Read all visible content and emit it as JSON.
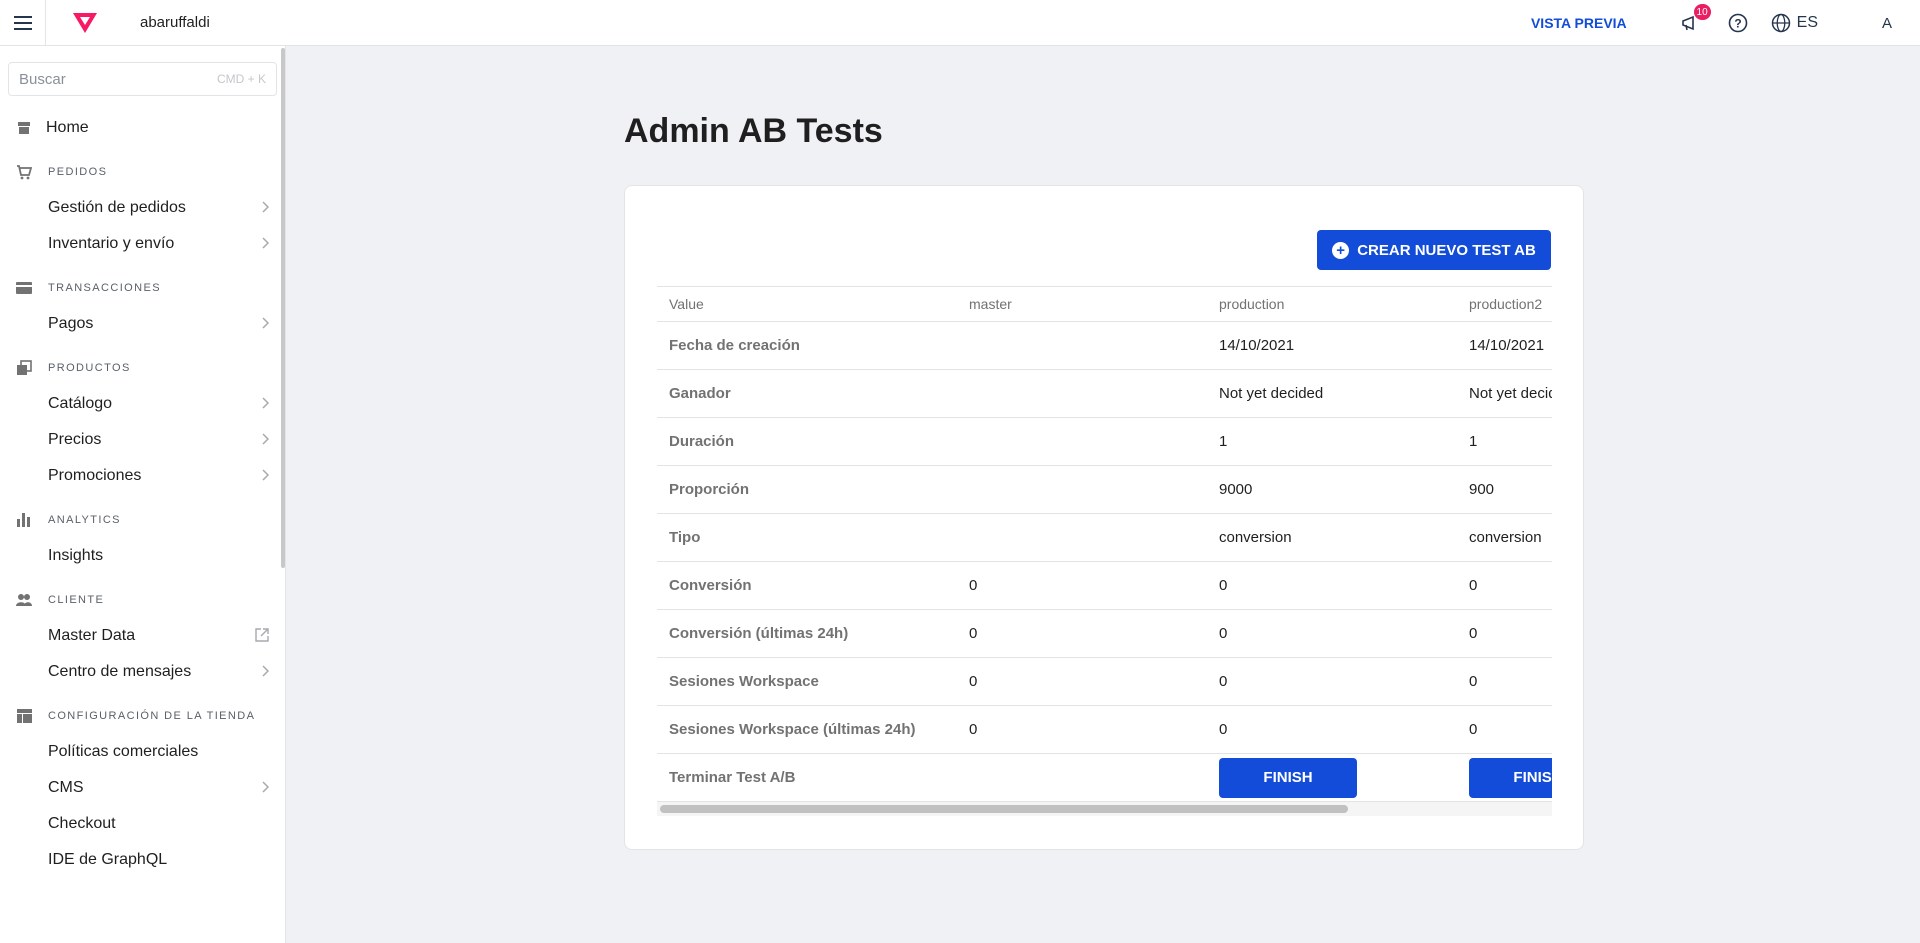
{
  "topbar": {
    "account_name": "abaruffaldi",
    "preview_label": "VISTA PREVIA",
    "notifications_count": "10",
    "language": "ES",
    "avatar_initial": "A"
  },
  "sidebar": {
    "search_placeholder": "Buscar",
    "search_shortcut": "CMD + K",
    "home": "Home",
    "sections": [
      {
        "title": "PEDIDOS",
        "icon": "cart-icon",
        "items": [
          {
            "label": "Gestión de pedidos",
            "trail": "chevron"
          },
          {
            "label": "Inventario y envío",
            "trail": "chevron"
          }
        ]
      },
      {
        "title": "TRANSACCIONES",
        "icon": "credit-card-icon",
        "items": [
          {
            "label": "Pagos",
            "trail": "chevron"
          }
        ]
      },
      {
        "title": "PRODUCTOS",
        "icon": "products-icon",
        "items": [
          {
            "label": "Catálogo",
            "trail": "chevron"
          },
          {
            "label": "Precios",
            "trail": "chevron"
          },
          {
            "label": "Promociones",
            "trail": "chevron"
          }
        ]
      },
      {
        "title": "ANALYTICS",
        "icon": "bar-chart-icon",
        "items": [
          {
            "label": "Insights",
            "trail": ""
          }
        ]
      },
      {
        "title": "CLIENTE",
        "icon": "users-icon",
        "items": [
          {
            "label": "Master Data",
            "trail": "external"
          },
          {
            "label": "Centro de mensajes",
            "trail": "chevron"
          }
        ]
      },
      {
        "title": "CONFIGURACIÓN DE LA TIENDA",
        "icon": "store-layout-icon",
        "items": [
          {
            "label": "Políticas comerciales",
            "trail": ""
          },
          {
            "label": "CMS",
            "trail": "chevron"
          },
          {
            "label": "Checkout",
            "trail": ""
          },
          {
            "label": "IDE de GraphQL",
            "trail": ""
          }
        ]
      }
    ]
  },
  "main": {
    "title": "Admin AB Tests",
    "create_button": "CREAR NUEVO TEST AB",
    "table": {
      "headers": [
        "Value",
        "master",
        "production",
        "production2"
      ],
      "rows": [
        [
          "Fecha de creación",
          "",
          "14/10/2021",
          "14/10/2021"
        ],
        [
          "Ganador",
          "",
          "Not yet decided",
          "Not yet decided"
        ],
        [
          "Duración",
          "",
          "1",
          "1"
        ],
        [
          "Proporción",
          "",
          "9000",
          "900"
        ],
        [
          "Tipo",
          "",
          "conversion",
          "conversion"
        ],
        [
          "Conversión",
          "0",
          "0",
          "0"
        ],
        [
          "Conversión (últimas 24h)",
          "0",
          "0",
          "0"
        ],
        [
          "Sesiones Workspace",
          "0",
          "0",
          "0"
        ],
        [
          "Sesiones Workspace (últimas 24h)",
          "0",
          "0",
          "0"
        ]
      ],
      "last_row_label": "Terminar Test A/B",
      "finish_label": "FINISH"
    }
  }
}
